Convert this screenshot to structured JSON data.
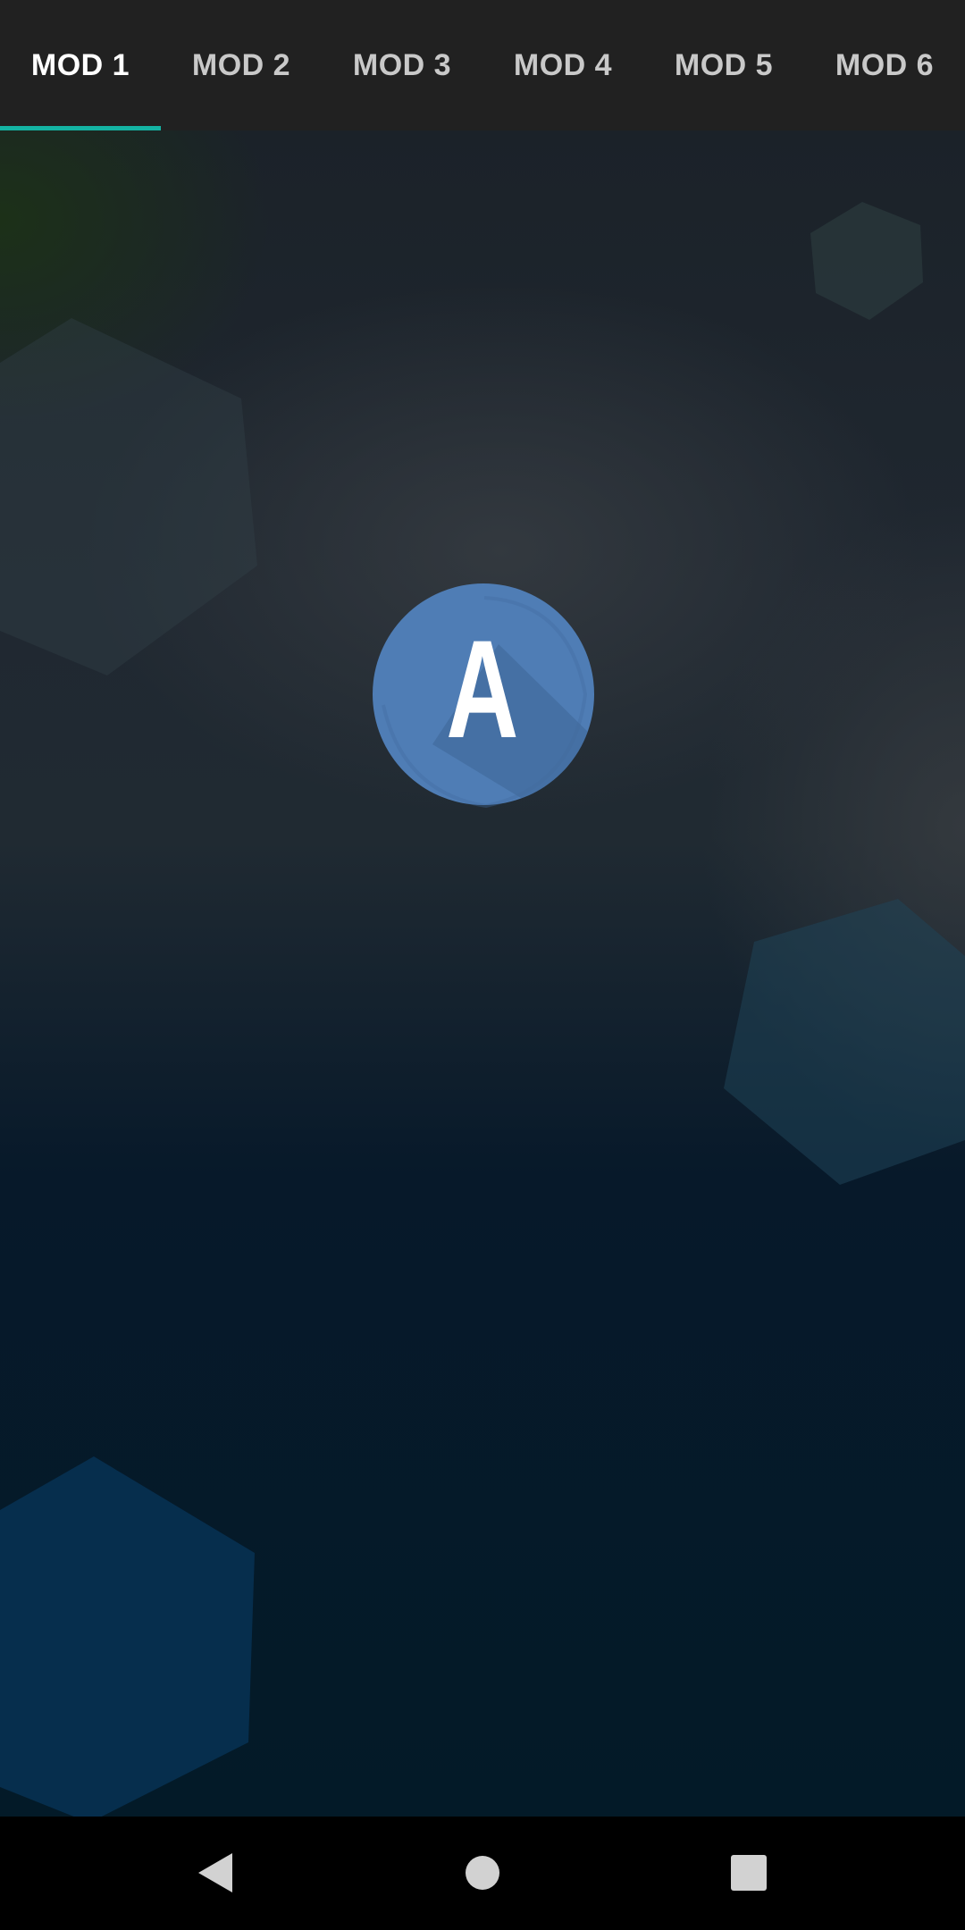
{
  "tabs": [
    {
      "label": "MOD 1",
      "active": true
    },
    {
      "label": "MOD 2",
      "active": false
    },
    {
      "label": "MOD 3",
      "active": false
    },
    {
      "label": "MOD 4",
      "active": false
    },
    {
      "label": "MOD 5",
      "active": false
    },
    {
      "label": "MOD 6",
      "active": false
    }
  ],
  "center_avatar": {
    "letter": "A",
    "icon": "letter-a-badge"
  },
  "navigation": {
    "back": "back-icon",
    "home": "home-icon",
    "recents": "recents-icon"
  },
  "colors": {
    "tab_bar": "#212121",
    "active_tab_text": "#ffffff",
    "inactive_tab_text": "#c9c9c9",
    "tab_indicator": "#14b3a3",
    "background_dark": "#031a28",
    "avatar_blue": "#4f7db5",
    "nav_bar": "#000000",
    "nav_icon": "#d2d2d2"
  }
}
